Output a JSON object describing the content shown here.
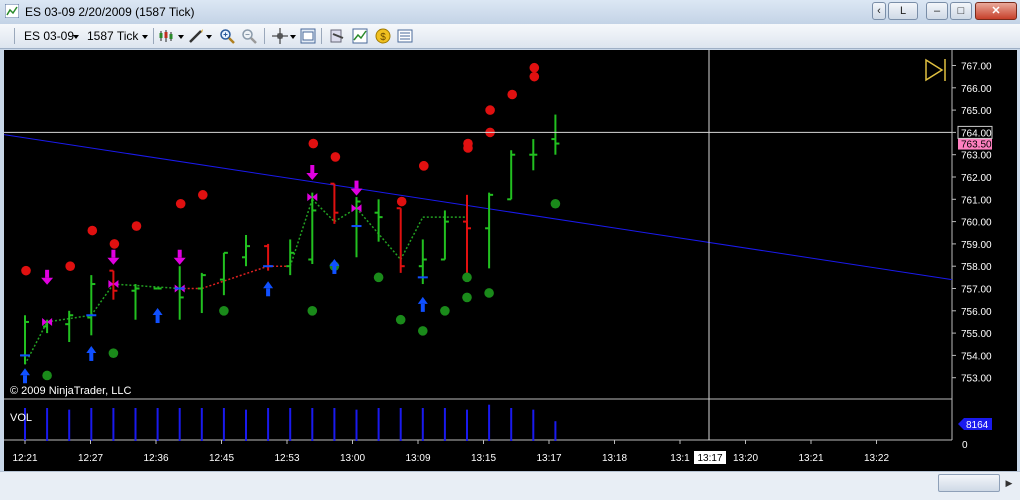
{
  "window": {
    "title": "ES 03-09  2/20/2009 (1587 Tick)",
    "link_button_label": "L"
  },
  "toolbar": {
    "instrument": "ES 03-09",
    "interval": "1587 Tick",
    "icons": [
      "bar-style-icon",
      "drawing-tools-icon",
      "zoom-in-icon",
      "zoom-out-icon",
      "crosshair-icon",
      "properties-icon",
      "strategies-icon",
      "indicators-icon",
      "money-icon",
      "data-box-icon"
    ]
  },
  "chart": {
    "copyright": "© 2009 NinjaTrader, LLC",
    "volume_label": "VOL",
    "volume_value_badge": "8164",
    "volume_zero_label": "0",
    "price_axis_labels": [
      "767.00",
      "766.00",
      "765.00",
      "764.00",
      "763.00",
      "762.00",
      "761.00",
      "760.00",
      "759.00",
      "758.00",
      "757.00",
      "756.00",
      "755.00",
      "754.00",
      "753.00"
    ],
    "crosshair_price_label": "764.00",
    "last_price_label": "763.50",
    "time_axis_labels": [
      "12:21",
      "12:27",
      "12:36",
      "12:45",
      "12:53",
      "13:00",
      "13:09",
      "13:15",
      "13:17",
      "13:18",
      "13:1",
      "13:20",
      "13:21",
      "13:22"
    ],
    "crosshair_time_label": "13:17",
    "colors": {
      "background": "#000000",
      "up_bar": "#22c020",
      "down_bar": "#e01010",
      "trend_line": "#1a1aee",
      "signal_arrow": "#e000e0",
      "long_arrow": "#1050ff",
      "upper_dot": "#e01010",
      "lower_dot": "#1a8a1a",
      "volume": "#1a1aee",
      "crosshair": "#d8d8d8"
    }
  },
  "chart_data": {
    "type": "ohlc",
    "title": "ES 03-09  2/20/2009 (1587 Tick)",
    "ylim": [
      752.6,
      767.4
    ],
    "bars": [
      {
        "x": "12:21",
        "o": 754.0,
        "h": 755.8,
        "l": 753.6,
        "c": 755.5,
        "dir": "up"
      },
      {
        "x": "12:24",
        "o": 755.3,
        "h": 755.6,
        "l": 755.0,
        "c": 755.5,
        "dir": "up"
      },
      {
        "x": "12:25",
        "o": 755.4,
        "h": 756.0,
        "l": 754.6,
        "c": 755.8,
        "dir": "up"
      },
      {
        "x": "12:27",
        "o": 755.7,
        "h": 757.6,
        "l": 754.9,
        "c": 757.2,
        "dir": "up"
      },
      {
        "x": "12:29",
        "o": 757.8,
        "h": 757.8,
        "l": 756.5,
        "c": 756.9,
        "dir": "down"
      },
      {
        "x": "12:32",
        "o": 756.9,
        "h": 757.2,
        "l": 755.6,
        "c": 757.0,
        "dir": "up"
      },
      {
        "x": "12:34",
        "o": 757.0,
        "h": 757.0,
        "l": 757.0,
        "c": 757.0,
        "dir": "up"
      },
      {
        "x": "12:36",
        "o": 757.0,
        "h": 758.0,
        "l": 755.6,
        "c": 756.6,
        "dir": "up"
      },
      {
        "x": "12:39",
        "o": 757.0,
        "h": 757.7,
        "l": 755.9,
        "c": 757.6,
        "dir": "up"
      },
      {
        "x": "12:42",
        "o": 757.4,
        "h": 758.6,
        "l": 756.7,
        "c": 758.6,
        "dir": "up"
      },
      {
        "x": "12:44",
        "o": 758.4,
        "h": 759.4,
        "l": 758.0,
        "c": 758.9,
        "dir": "up"
      },
      {
        "x": "12:46",
        "o": 758.9,
        "h": 759.0,
        "l": 757.8,
        "c": 758.0,
        "dir": "down"
      },
      {
        "x": "12:51",
        "o": 758.0,
        "h": 759.2,
        "l": 757.6,
        "c": 758.6,
        "dir": "up"
      },
      {
        "x": "12:53",
        "o": 758.3,
        "h": 761.3,
        "l": 758.1,
        "c": 760.5,
        "dir": "up"
      },
      {
        "x": "12:55",
        "o": 761.7,
        "h": 761.7,
        "l": 759.9,
        "c": 760.4,
        "dir": "down"
      },
      {
        "x": "12:58",
        "o": 760.6,
        "h": 761.1,
        "l": 758.4,
        "c": 760.9,
        "dir": "up"
      },
      {
        "x": "13:00",
        "o": 760.4,
        "h": 761.0,
        "l": 759.1,
        "c": 760.2,
        "dir": "up"
      },
      {
        "x": "13:03",
        "o": 760.6,
        "h": 760.6,
        "l": 757.7,
        "c": 758.0,
        "dir": "down"
      },
      {
        "x": "13:07",
        "o": 758.0,
        "h": 759.2,
        "l": 757.2,
        "c": 758.3,
        "dir": "up"
      },
      {
        "x": "13:09",
        "o": 758.3,
        "h": 760.5,
        "l": 758.3,
        "c": 760.0,
        "dir": "up"
      },
      {
        "x": "13:11",
        "o": 760.0,
        "h": 761.2,
        "l": 757.5,
        "c": 759.7,
        "dir": "down"
      },
      {
        "x": "13:13",
        "o": 759.7,
        "h": 761.3,
        "l": 757.9,
        "c": 761.2,
        "dir": "up"
      },
      {
        "x": "13:15",
        "o": 761.0,
        "h": 763.2,
        "l": 761.0,
        "c": 763.0,
        "dir": "up"
      },
      {
        "x": "13:16",
        "o": 763.0,
        "h": 763.7,
        "l": 762.3,
        "c": 763.0,
        "dir": "up"
      },
      {
        "x": "13:17",
        "o": 763.7,
        "h": 764.8,
        "l": 763.0,
        "c": 763.5,
        "dir": "up"
      }
    ],
    "upper_dots": [
      757.8,
      758.0,
      759.6,
      759.0,
      759.8,
      760.8,
      761.2,
      763.5,
      762.9,
      760.9,
      762.5,
      762.5,
      763.3,
      763.5,
      764.0,
      765.0,
      765.7,
      766.5,
      766.9
    ],
    "lower_dots": [
      753.1,
      754.1,
      756.0,
      756.0,
      758.0,
      757.5,
      755.6,
      755.1,
      756.0,
      756.6,
      757.5,
      756.8,
      760.8
    ],
    "trend_line": {
      "from": [
        0,
        763.9
      ],
      "to": [
        1,
        757.4
      ]
    },
    "volume": [
      1.0,
      1.0,
      0.95,
      1.0,
      1.0,
      1.0,
      1.0,
      1.0,
      1.0,
      1.0,
      0.95,
      1.0,
      1.0,
      1.0,
      1.0,
      0.95,
      1.0,
      1.0,
      1.0,
      1.0,
      0.95,
      1.1,
      1.0,
      0.95,
      0.6
    ]
  }
}
